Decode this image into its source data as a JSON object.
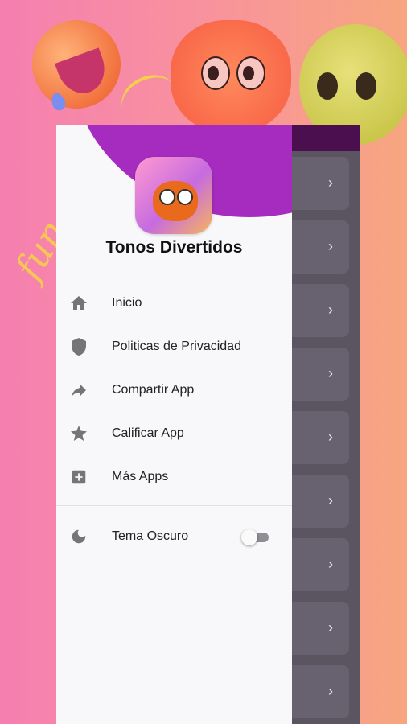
{
  "app": {
    "title": "Tonos Divertidos"
  },
  "menu": {
    "items": [
      {
        "label": "Inicio",
        "icon": "home-icon"
      },
      {
        "label": "Politicas de Privacidad",
        "icon": "shield-icon"
      },
      {
        "label": "Compartir App",
        "icon": "share-icon"
      },
      {
        "label": "Calificar App",
        "icon": "star-icon"
      },
      {
        "label": "Más Apps",
        "icon": "add-box-icon"
      }
    ],
    "dark_mode": {
      "label": "Tema Oscuro",
      "icon": "moon-icon",
      "enabled": false
    }
  },
  "background": {
    "fun_text": "fun"
  },
  "colors": {
    "header_purple": "#a52cbf",
    "appbar": "#4b0f4f",
    "list_card": "#676170",
    "icon_gray": "#757575"
  }
}
